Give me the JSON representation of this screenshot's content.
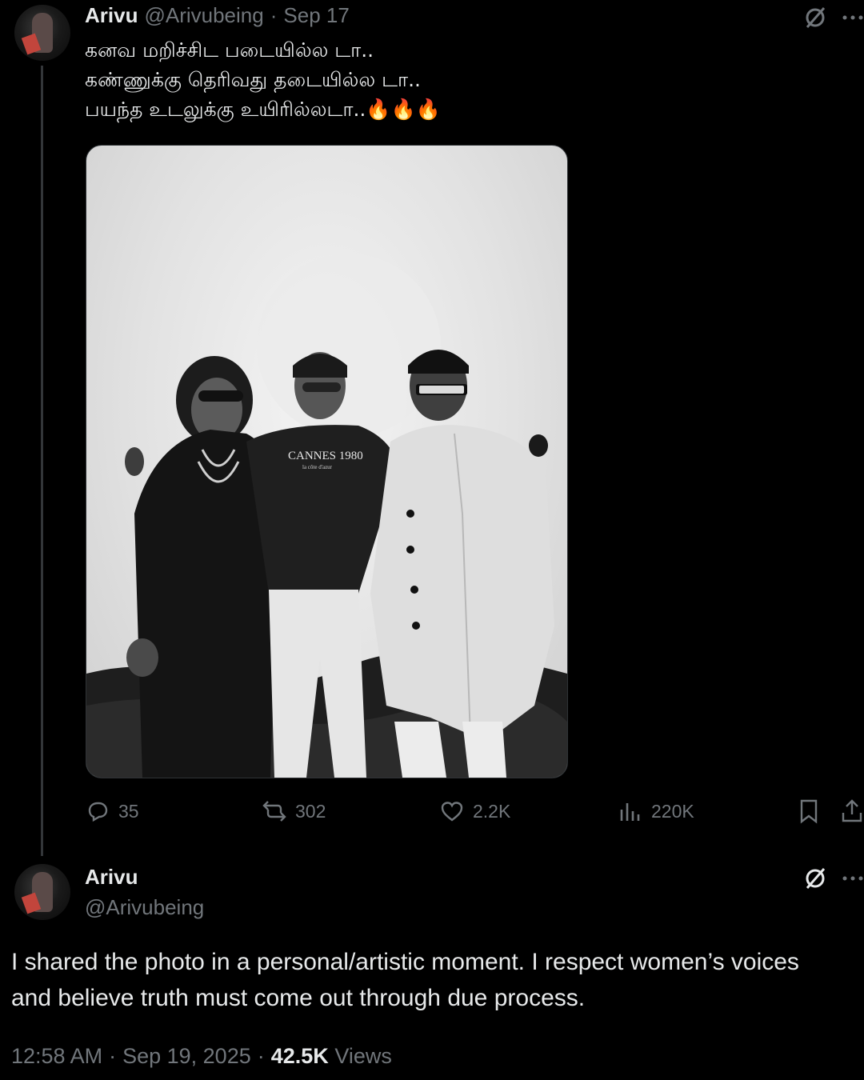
{
  "tweet": {
    "author_name": "Arivu",
    "handle": "@Arivubeing",
    "separator": "·",
    "date": "Sep 17",
    "lines": [
      "கனவ மறிச்சிட படையில்ல டா..",
      "கண்ணுக்கு தெரிவது தடையில்ல டா..",
      "பயந்த உடலுக்கு உயிரில்லடா.."
    ],
    "emojis": "🔥🔥🔥",
    "media_shirt_text": "CANNES 1980",
    "media_shirt_subtext": "la côte d'azur",
    "stats": {
      "replies": "35",
      "reposts": "302",
      "likes": "2.2K",
      "views": "220K"
    }
  },
  "reply": {
    "author_name": "Arivu",
    "handle": "@Arivubeing",
    "text": "I shared the photo in a personal/artistic moment. I respect women’s voices and believe truth must come out through due process.",
    "time": "12:58 AM",
    "separator": "·",
    "date": "Sep 19, 2025",
    "views_count": "42.5K",
    "views_label": "Views"
  },
  "icons": {
    "grok": "grok-icon",
    "more": "more-icon",
    "reply": "reply-icon",
    "repost": "repost-icon",
    "like": "like-icon",
    "views": "views-icon",
    "bookmark": "bookmark-icon",
    "share": "share-icon"
  },
  "colors": {
    "background": "#000000",
    "text": "#e7e9ea",
    "muted": "#71767b",
    "border": "#2f3336"
  }
}
